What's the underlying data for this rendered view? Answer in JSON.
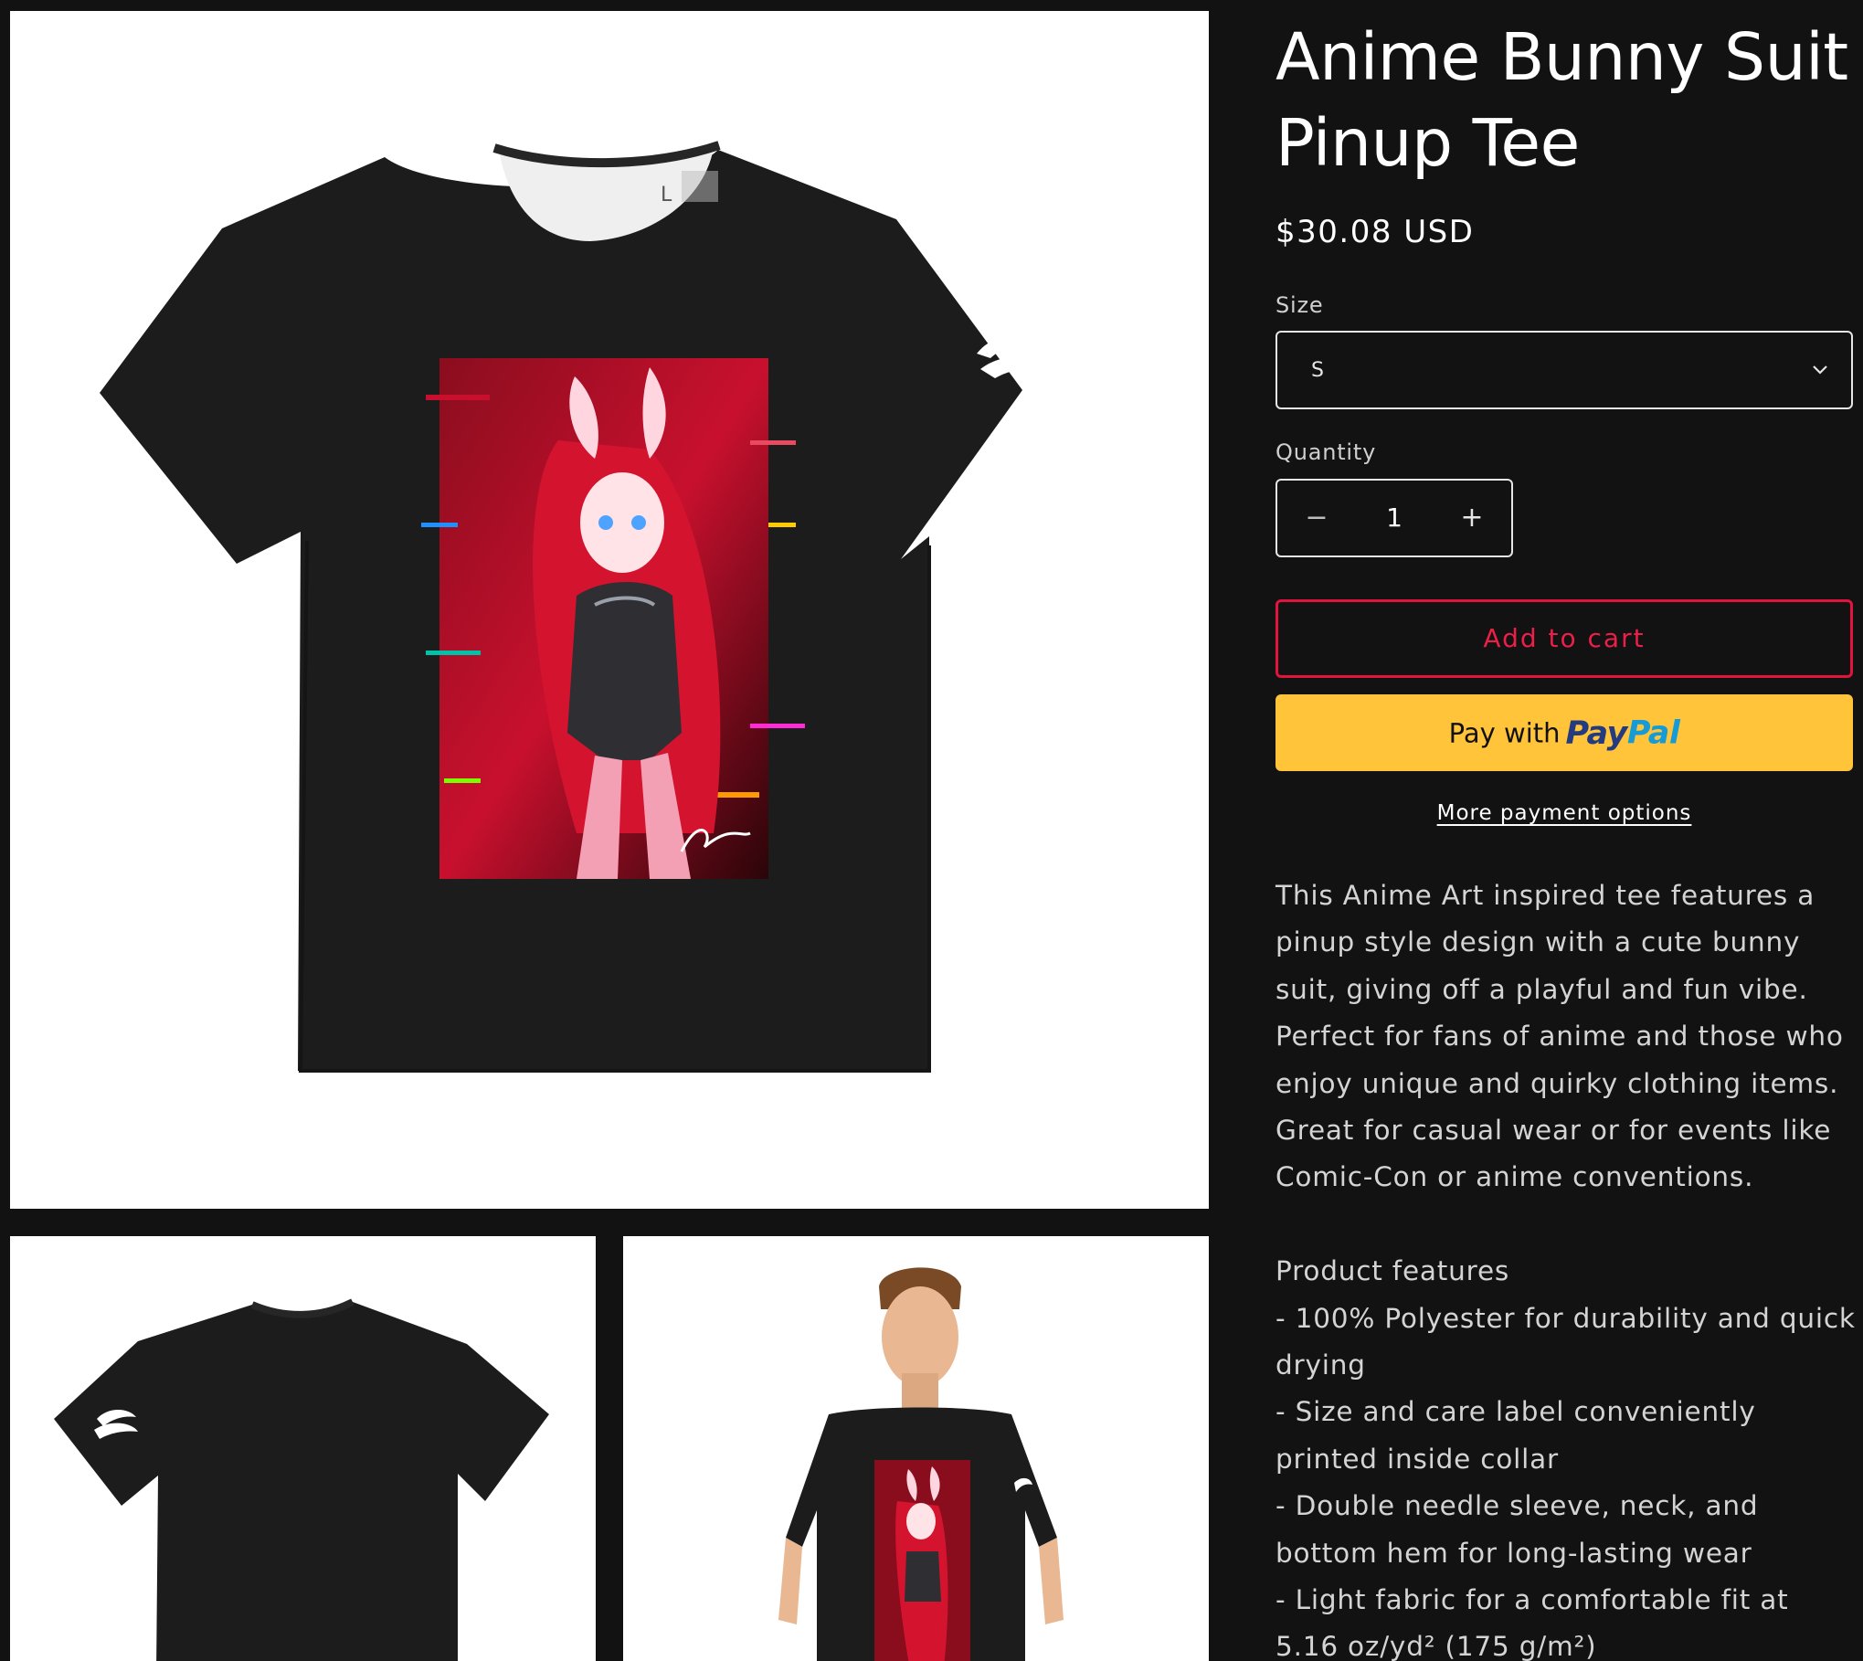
{
  "product": {
    "title": "Anime Bunny Suit Pinup Tee",
    "price": "$30.08 USD"
  },
  "size": {
    "label": "Size",
    "selected": "S"
  },
  "quantity": {
    "label": "Quantity",
    "value": "1",
    "minus": "−",
    "plus": "+"
  },
  "actions": {
    "add_to_cart": "Add to cart",
    "paypal_prefix": "Pay with",
    "paypal_brand_1": "Pay",
    "paypal_brand_2": "Pal",
    "more_payment": "More payment options"
  },
  "description": {
    "intro": "This Anime Art inspired tee features a pinup style design with a cute bunny suit, giving off a playful and fun vibe. Perfect for fans of anime and those who enjoy unique and quirky clothing items. Great for casual wear or for events like Comic-Con or anime conventions.",
    "features_heading": "Product features",
    "features": [
      "- 100% Polyester for durability and quick drying",
      "- Size and care label conveniently printed inside collar",
      "- Double needle sleeve, neck, and bottom hem for long-lasting wear",
      "- Light fabric for a comfortable fit at 5.16 oz/yd² (175 g/m²)"
    ]
  },
  "gallery": {
    "tag_letter": "L"
  },
  "colors": {
    "background": "#121212",
    "accent_red": "#e0143c",
    "paypal_yellow": "#ffc439",
    "paypal_dark_blue": "#253b80",
    "paypal_light_blue": "#179bd7",
    "shirt": "#1c1c1c",
    "art_red": "#c8102e"
  }
}
